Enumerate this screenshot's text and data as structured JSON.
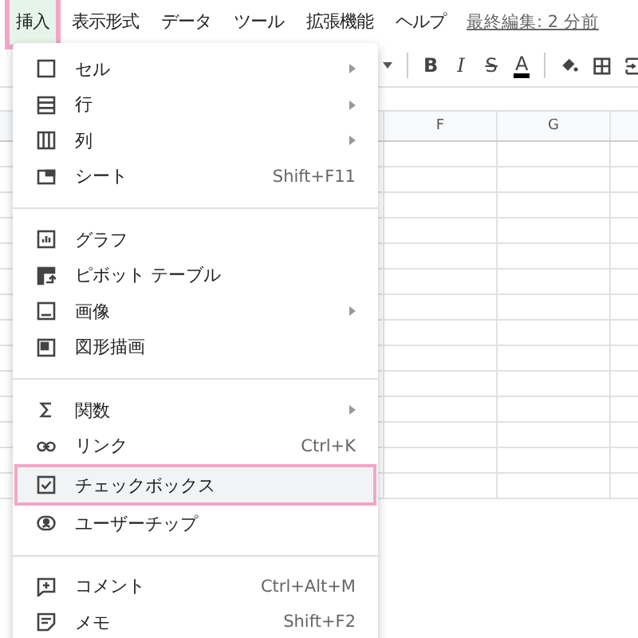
{
  "menubar": {
    "items": [
      {
        "label": "挿入",
        "selected": true
      },
      {
        "label": "表示形式",
        "selected": false
      },
      {
        "label": "データ",
        "selected": false
      },
      {
        "label": "ツール",
        "selected": false
      },
      {
        "label": "拡張機能",
        "selected": false
      },
      {
        "label": "ヘルプ",
        "selected": false
      }
    ],
    "last_edit": "最終編集: 2 分前"
  },
  "toolbar": {
    "format_buttons": [
      "B",
      "I",
      "S",
      "A"
    ]
  },
  "sheet": {
    "columns": [
      "F",
      "G"
    ]
  },
  "insert_menu": {
    "sections": [
      [
        {
          "kind": "cell",
          "label": "セル",
          "submenu": true,
          "highlighted": false
        },
        {
          "kind": "row",
          "label": "行",
          "submenu": true,
          "highlighted": false
        },
        {
          "kind": "column",
          "label": "列",
          "submenu": true,
          "highlighted": false
        },
        {
          "kind": "sheet",
          "label": "シート",
          "shortcut": "Shift+F11",
          "submenu": false,
          "highlighted": false
        }
      ],
      [
        {
          "kind": "chart",
          "label": "グラフ",
          "submenu": false,
          "highlighted": false
        },
        {
          "kind": "pivot",
          "label": "ピボット テーブル",
          "submenu": false,
          "highlighted": false
        },
        {
          "kind": "image",
          "label": "画像",
          "submenu": true,
          "highlighted": false
        },
        {
          "kind": "drawing",
          "label": "図形描画",
          "submenu": false,
          "highlighted": false
        }
      ],
      [
        {
          "kind": "function",
          "label": "関数",
          "submenu": true,
          "highlighted": false
        },
        {
          "kind": "link",
          "label": "リンク",
          "shortcut": "Ctrl+K",
          "submenu": false,
          "highlighted": false
        },
        {
          "kind": "checkbox",
          "label": "チェックボックス",
          "submenu": false,
          "highlighted": true
        },
        {
          "kind": "chip",
          "label": "ユーザーチップ",
          "submenu": false,
          "highlighted": false
        }
      ],
      [
        {
          "kind": "comment",
          "label": "コメント",
          "shortcut": "Ctrl+Alt+M",
          "submenu": false,
          "highlighted": false
        },
        {
          "kind": "note",
          "label": "メモ",
          "shortcut": "Shift+F2",
          "submenu": false,
          "highlighted": false
        }
      ]
    ]
  }
}
